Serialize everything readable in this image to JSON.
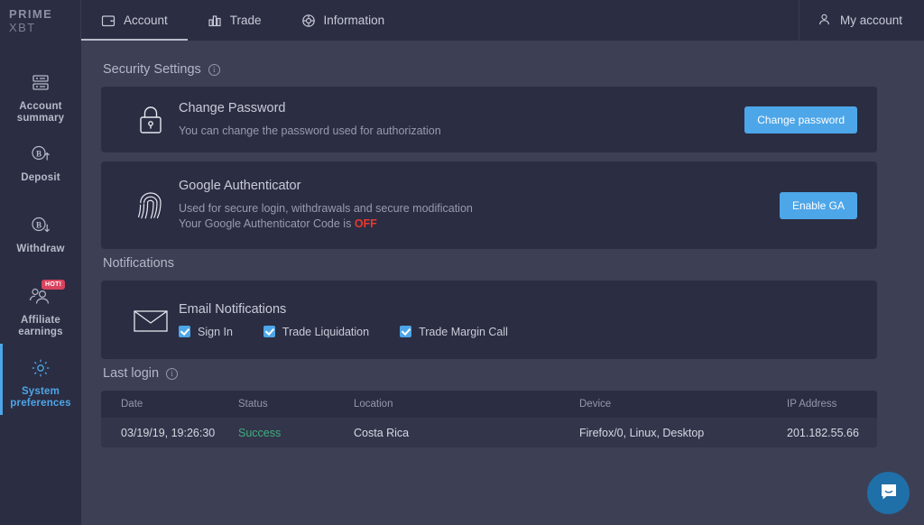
{
  "header": {
    "logo_prime": "PRIME",
    "logo_xbt": "XBT",
    "nav": [
      {
        "label": "Account",
        "icon": "wallet-icon",
        "active": true
      },
      {
        "label": "Trade",
        "icon": "bar-chart-icon",
        "active": false
      },
      {
        "label": "Information",
        "icon": "info-wheel-icon",
        "active": false
      }
    ],
    "my_account": "My account"
  },
  "sidebar": {
    "items": [
      {
        "label": "Account summary",
        "icon": "server-icon",
        "active": false,
        "badge": ""
      },
      {
        "label": "Deposit",
        "icon": "bitcoin-up-icon",
        "active": false,
        "badge": ""
      },
      {
        "label": "Withdraw",
        "icon": "bitcoin-down-icon",
        "active": false,
        "badge": ""
      },
      {
        "label": "Affiliate earnings",
        "icon": "users-icon",
        "active": false,
        "badge": "HOT!"
      },
      {
        "label": "System preferences",
        "icon": "gear-icon",
        "active": true,
        "badge": ""
      }
    ]
  },
  "security": {
    "section_title": "Security Settings",
    "password": {
      "title": "Change Password",
      "desc": "You can change the password used for authorization",
      "button": "Change password"
    },
    "ga": {
      "title": "Google Authenticator",
      "desc_line1": "Used for secure login, withdrawals and secure modification",
      "desc_line2_prefix": "Your Google Authenticator Code is ",
      "status": "OFF",
      "button": "Enable GA"
    }
  },
  "notifications": {
    "section_title": "Notifications",
    "email": {
      "title": "Email Notifications",
      "options": [
        {
          "label": "Sign In",
          "checked": true
        },
        {
          "label": "Trade Liquidation",
          "checked": true
        },
        {
          "label": "Trade Margin Call",
          "checked": true
        }
      ]
    }
  },
  "last_login": {
    "section_title": "Last login",
    "columns": [
      "Date",
      "Status",
      "Location",
      "Device",
      "IP Address"
    ],
    "rows": [
      {
        "date": "03/19/19, 19:26:30",
        "status": "Success",
        "location": "Costa Rica",
        "device": "Firefox/0, Linux, Desktop",
        "ip": "201.182.55.66"
      }
    ]
  },
  "chat": {
    "icon": "chat-bubble-icon"
  },
  "colors": {
    "accent": "#4da6e8",
    "danger": "#e8392f",
    "success": "#3fae7e",
    "card_bg": "#2b2d42",
    "page_bg": "#3d3f55"
  }
}
